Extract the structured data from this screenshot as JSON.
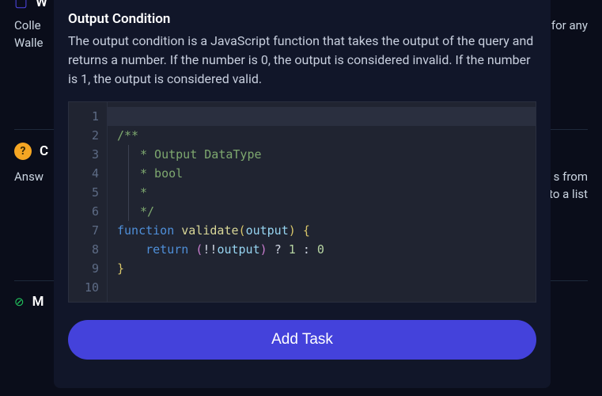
{
  "modal": {
    "title": "Output Condition",
    "description": "The output condition is a JavaScript function that takes the output of the query and returns a number. If the number is 0, the output is considered invalid. If the number is 1, the output is considered valid.",
    "button_label": "Add Task"
  },
  "code": {
    "lines": [
      "",
      "/**",
      " * Output DataType",
      " * bool",
      " *",
      " */",
      "function validate(output) {",
      "    return (!!output) ? 1 : 0",
      "}",
      ""
    ],
    "line_numbers": [
      "1",
      "2",
      "3",
      "4",
      "5",
      "6",
      "7",
      "8",
      "9",
      "10"
    ]
  },
  "background": {
    "frag_w": "W",
    "frag_colle": "Colle",
    "frag_walle": "Walle",
    "frag_for_any": "for any",
    "frag_c": "C",
    "frag_answ": "Answ",
    "frag_s_from": "s from",
    "frag_to_a_list": "to a list",
    "frag_m": "M"
  }
}
